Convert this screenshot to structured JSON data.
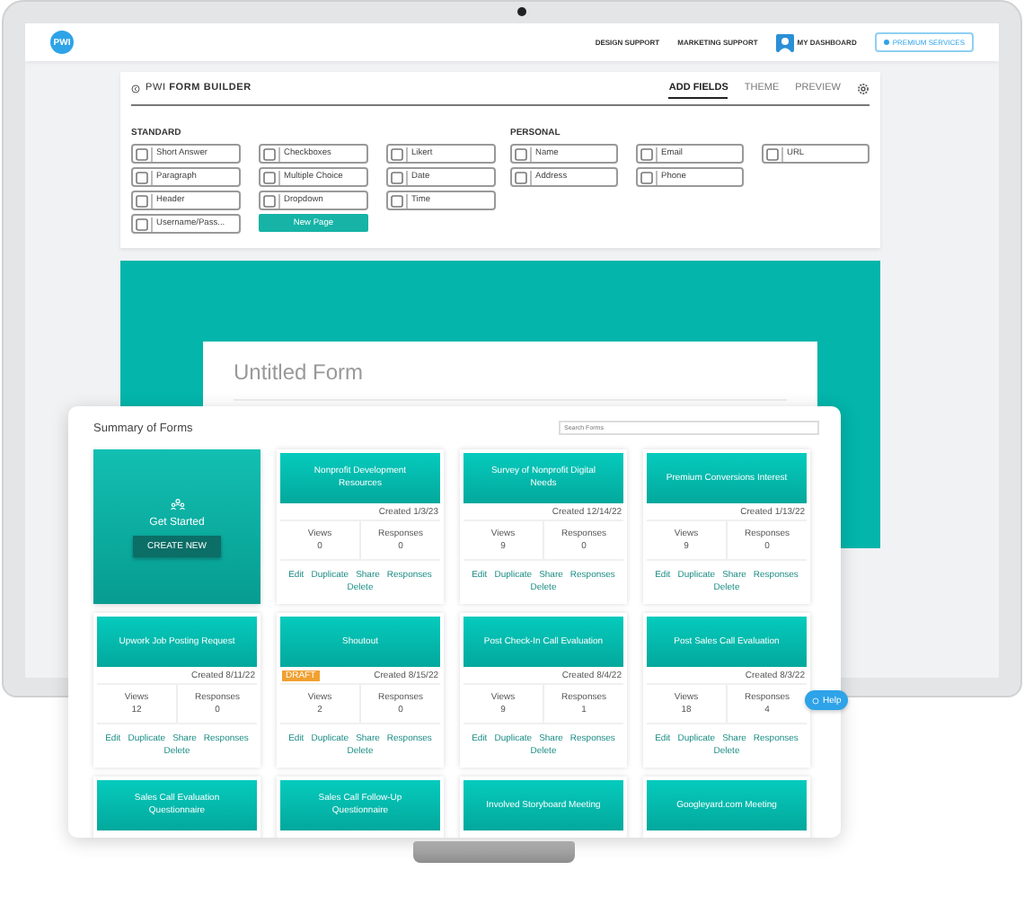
{
  "nav": {
    "logo": "PWI",
    "links": [
      "DESIGN SUPPORT",
      "MARKETING SUPPORT"
    ],
    "dashboard": "MY DASHBOARD",
    "premium": "PREMIUM SERVICES"
  },
  "builder": {
    "title": "PWI **FORM BUILDER**",
    "tabs": [
      {
        "label": "ADD FIELDS",
        "selected": true
      },
      {
        "label": "THEME",
        "selected": false
      },
      {
        "label": "PREVIEW",
        "selected": false
      }
    ],
    "sections": [
      {
        "heading": "STANDARD",
        "columns": [
          [
            "Short Answer",
            "Paragraph",
            "Header",
            "Username/Pass..."
          ],
          [
            "Checkboxes",
            "Multiple Choice",
            "Dropdown"
          ],
          [
            "Likert",
            "Date",
            "Time"
          ]
        ],
        "button": "New Page"
      },
      {
        "heading": "PERSONAL",
        "columns": [
          [
            "Name",
            "Address"
          ],
          [
            "Email",
            "Phone"
          ],
          [
            "URL"
          ]
        ]
      }
    ]
  },
  "form": {
    "title": "Untitled Form"
  },
  "summary": {
    "title": "Summary of Forms",
    "search_placeholder": "Search Forms",
    "start": {
      "label": "Get Started",
      "button": "CREATE NEW"
    },
    "cards": [
      {
        "title": "Nonprofit Development Resources",
        "created": "Created 1/3/23",
        "stats": [
          {
            "label": "Views",
            "value": "0"
          },
          {
            "label": "Responses",
            "value": "0"
          }
        ],
        "actions": [
          "Edit",
          "Duplicate",
          "Share",
          "Responses",
          "Delete"
        ]
      },
      {
        "title": "Survey of Nonprofit Digital Needs",
        "created": "Created 12/14/22",
        "stats": [
          {
            "label": "Views",
            "value": "9"
          },
          {
            "label": "Responses",
            "value": "0"
          }
        ],
        "actions": [
          "Edit",
          "Duplicate",
          "Share",
          "Responses",
          "Delete"
        ]
      },
      {
        "title": "Premium Conversions Interest",
        "created": "Created 1/13/22",
        "stats": [
          {
            "label": "Views",
            "value": "9"
          },
          {
            "label": "Responses",
            "value": "0"
          }
        ],
        "actions": [
          "Edit",
          "Duplicate",
          "Share",
          "Responses",
          "Delete"
        ]
      },
      {
        "title": "Upwork Job Posting Request",
        "created": "Created 8/11/22",
        "stats": [
          {
            "label": "Views",
            "value": "12"
          },
          {
            "label": "Responses",
            "value": "0"
          }
        ],
        "actions": [
          "Edit",
          "Duplicate",
          "Share",
          "Responses",
          "Delete"
        ]
      },
      {
        "title": "Shoutout",
        "badge": "DRAFT",
        "created": "Created 8/15/22",
        "stats": [
          {
            "label": "Views",
            "value": "2"
          },
          {
            "label": "Responses",
            "value": "0"
          }
        ],
        "actions": [
          "Edit",
          "Duplicate",
          "Share",
          "Responses",
          "Delete"
        ]
      },
      {
        "title": "Post Check-In Call Evaluation",
        "created": "Created 8/4/22",
        "stats": [
          {
            "label": "Views",
            "value": "9"
          },
          {
            "label": "Responses",
            "value": "1"
          }
        ],
        "actions": [
          "Edit",
          "Duplicate",
          "Share",
          "Responses",
          "Delete"
        ]
      },
      {
        "title": "Post Sales Call Evaluation",
        "created": "Created 8/3/22",
        "stats": [
          {
            "label": "Views",
            "value": "18"
          },
          {
            "label": "Responses",
            "value": "4"
          }
        ],
        "actions": [
          "Edit",
          "Duplicate",
          "Share",
          "Responses",
          "Delete"
        ]
      },
      {
        "title": "Sales Call Evaluation Questionnaire"
      },
      {
        "title": "Sales Call Follow-Up Questionnaire"
      },
      {
        "title": "Involved Storyboard Meeting"
      },
      {
        "title": "Googleyard.com Meeting"
      }
    ]
  },
  "help_button": "Help"
}
